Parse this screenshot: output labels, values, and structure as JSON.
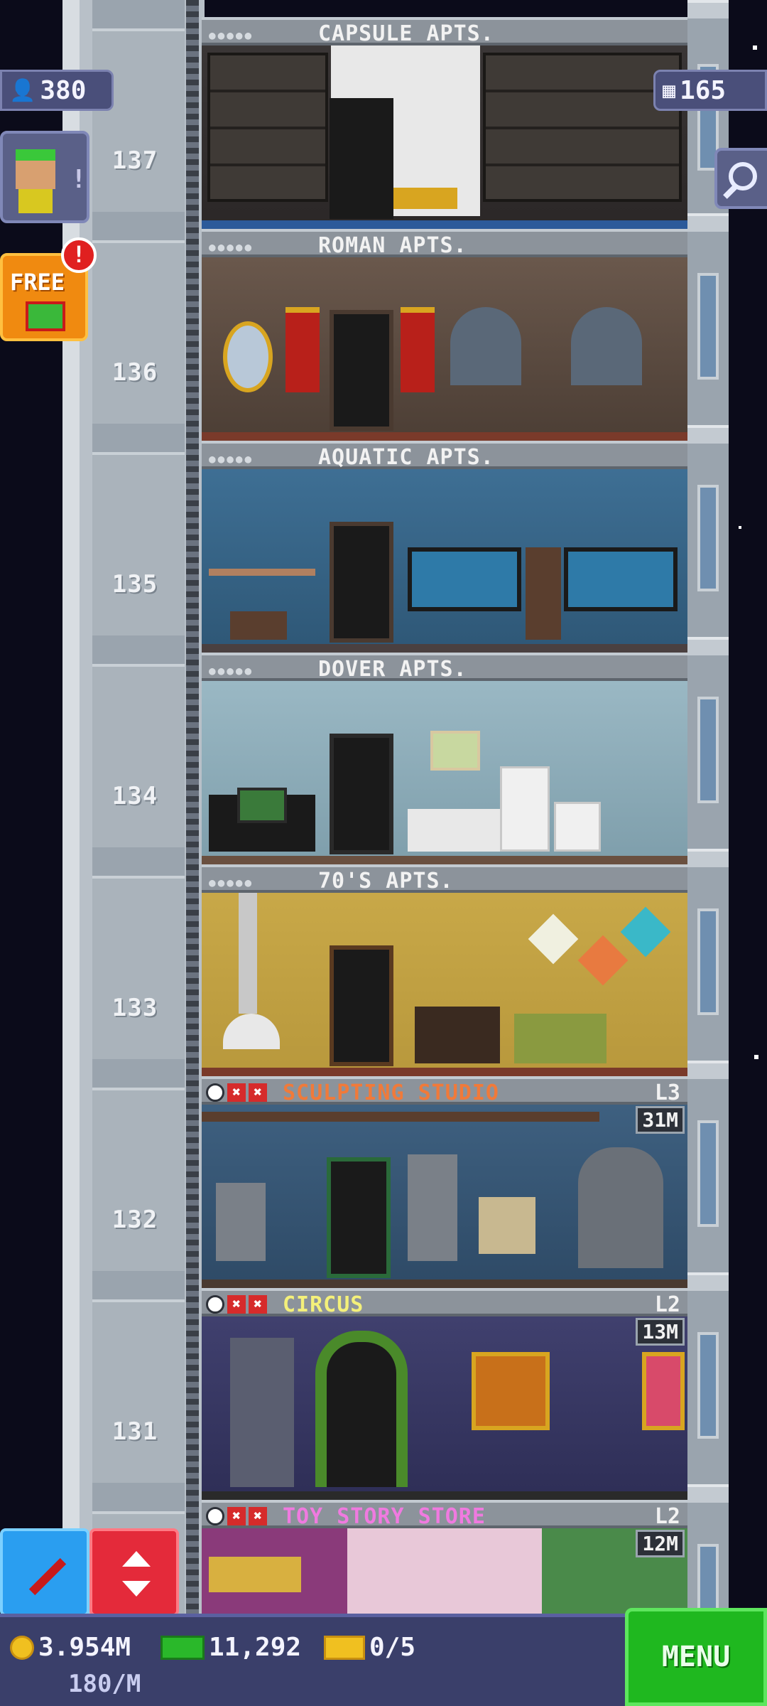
{
  "hud": {
    "population": "380",
    "floors_count": "165"
  },
  "side": {
    "free_label": "FREE",
    "alert": "!"
  },
  "shaft_floor_numbers": [
    "137",
    "136",
    "135",
    "134",
    "133",
    "132",
    "131"
  ],
  "floors": [
    {
      "name": "CAPSULE APTS.",
      "type": "residential"
    },
    {
      "name": "ROMAN APTS.",
      "type": "residential"
    },
    {
      "name": "AQUATIC APTS.",
      "type": "residential"
    },
    {
      "name": "DOVER APTS.",
      "type": "residential"
    },
    {
      "name": "70'S APTS.",
      "type": "residential"
    },
    {
      "name": "SCULPTING STUDIO",
      "type": "business",
      "level": "L3",
      "stock": "31M",
      "title_color": "#f07a3a"
    },
    {
      "name": "CIRCUS",
      "type": "business",
      "level": "L2",
      "stock": "13M",
      "title_color": "#f4f07a"
    },
    {
      "name": "TOY STORY STORE",
      "type": "business",
      "level": "L2",
      "stock": "12M",
      "title_color": "#f07ae0"
    }
  ],
  "bottom_bar": {
    "coins": "3.954M",
    "bux": "11,292",
    "tickets": "0/5",
    "income_rate": "180/M",
    "menu_label": "MENU"
  },
  "colors": {
    "menu_green": "#1fb81f",
    "hud_purple": "#4a4f7a"
  }
}
